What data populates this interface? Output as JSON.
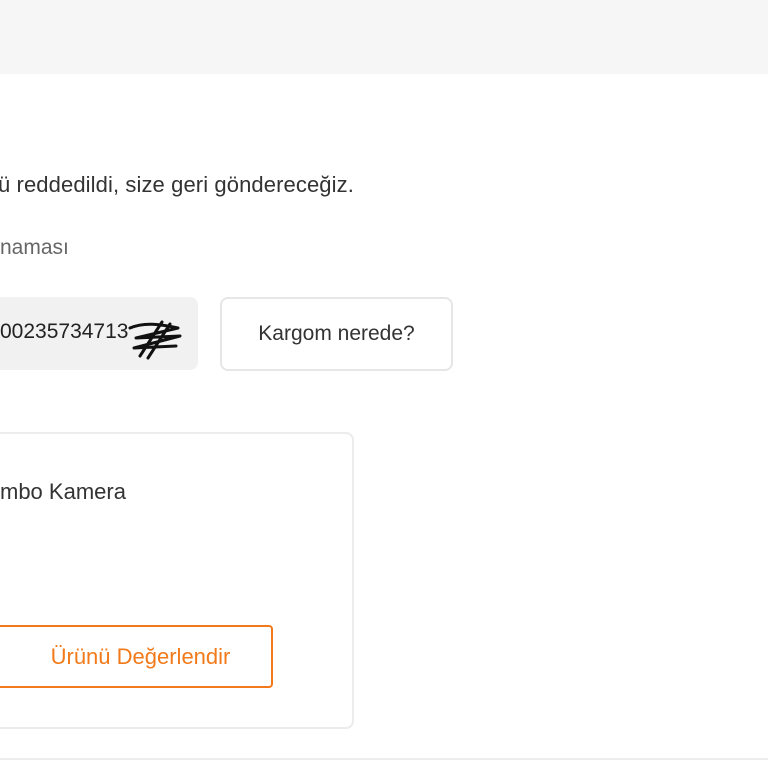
{
  "order": {
    "return_message": "ü reddedildi, size geri göndereceğiz.",
    "tracking_label": "naması",
    "tracking_number": "00235734713",
    "where_button_label": "Kargom nerede?"
  },
  "product": {
    "name": "mbo Kamera",
    "review_button_label": "Ürünü Değerlendir"
  },
  "colors": {
    "accent": "#f27a1a",
    "text": "#333333",
    "muted": "#666666",
    "tracking_bg": "#f1f1f1"
  }
}
